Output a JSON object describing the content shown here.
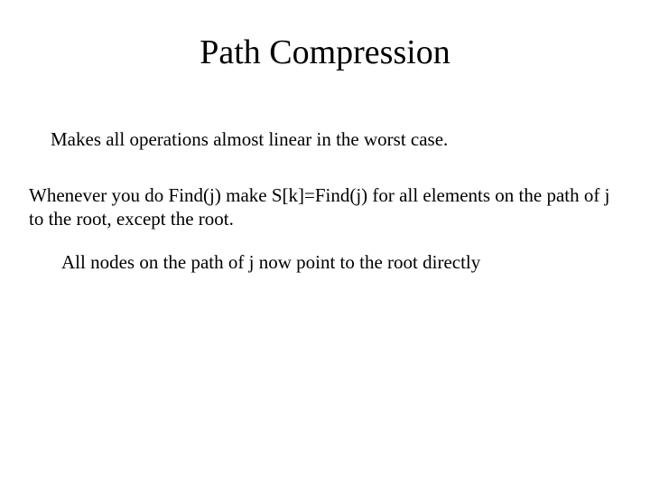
{
  "title": "Path Compression",
  "para1": "Makes all operations almost linear in the worst case.",
  "para2": "Whenever you do Find(j) make S[k]=Find(j) for all elements on the path of j to the root, except the root.",
  "para3": "All nodes on the path of j now point to the root directly"
}
